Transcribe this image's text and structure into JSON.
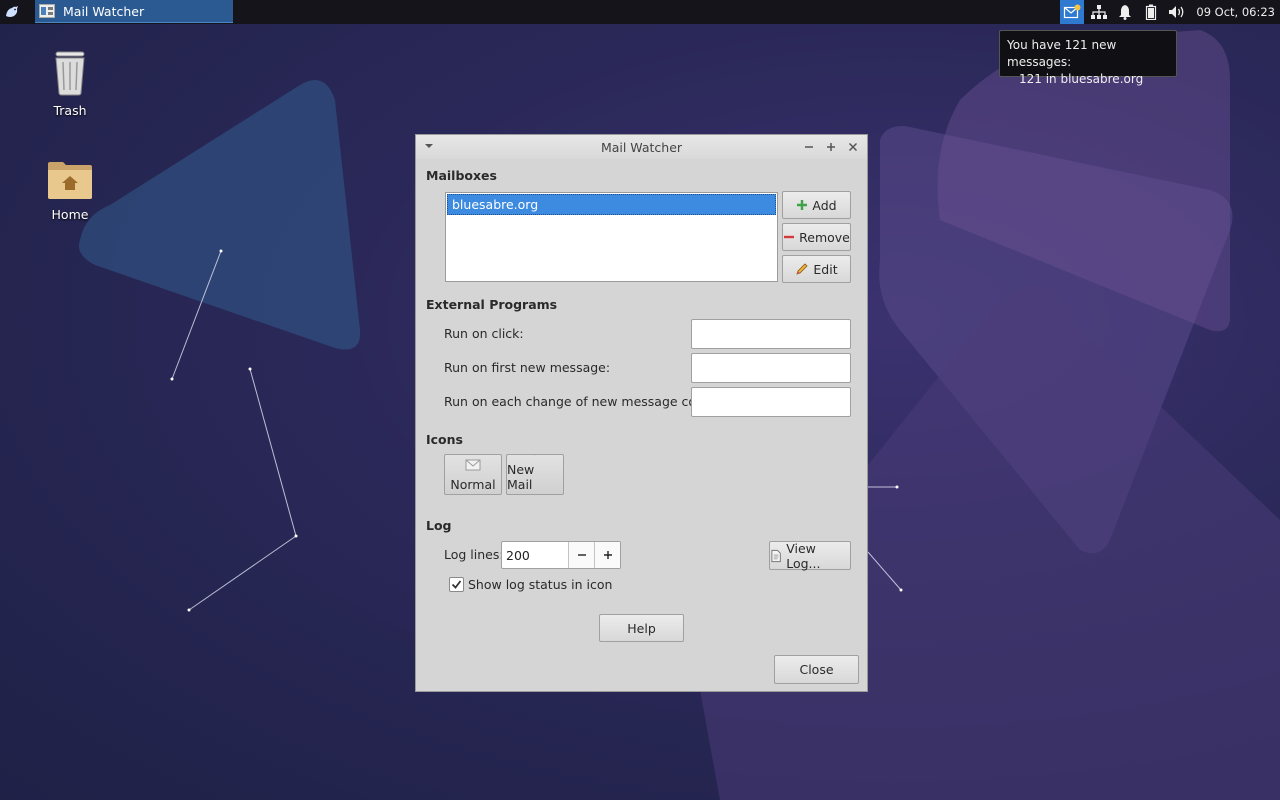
{
  "panel": {
    "task_title": "Mail Watcher",
    "clock": "09 Oct, 06:23",
    "tray_icons": [
      "mail-icon",
      "network-icon",
      "bell-icon",
      "battery-icon",
      "volume-icon"
    ]
  },
  "tooltip": {
    "line1": "You have 121 new messages:",
    "line2": "121 in bluesabre.org"
  },
  "desktop": {
    "items": [
      {
        "label": "Trash",
        "icon": "trash-icon"
      },
      {
        "label": "Home",
        "icon": "home-folder-icon"
      }
    ]
  },
  "dialog": {
    "title": "Mail Watcher",
    "mailboxes": {
      "heading": "Mailboxes",
      "items": [
        "bluesabre.org"
      ],
      "add_label": "Add",
      "remove_label": "Remove",
      "edit_label": "Edit"
    },
    "external": {
      "heading": "External Programs",
      "run_on_click": {
        "label": "Run on click:",
        "value": ""
      },
      "run_on_first": {
        "label": "Run on first new message:",
        "value": ""
      },
      "run_on_change": {
        "label": "Run on each change of new message count:",
        "value": ""
      }
    },
    "icons": {
      "heading": "Icons",
      "normal_label": "Normal",
      "new_mail_label": "New Mail"
    },
    "log": {
      "heading": "Log",
      "lines_label": "Log lines:",
      "lines_value": "200",
      "view_log_label": "View Log...",
      "show_status_label": "Show log status in icon",
      "show_status_checked": true
    },
    "help_label": "Help",
    "close_label": "Close"
  },
  "colors": {
    "accent": "#3d8be0",
    "panel": "#14141a",
    "dialog_bg": "#d5d5d5",
    "desktop": "#2a2858"
  }
}
